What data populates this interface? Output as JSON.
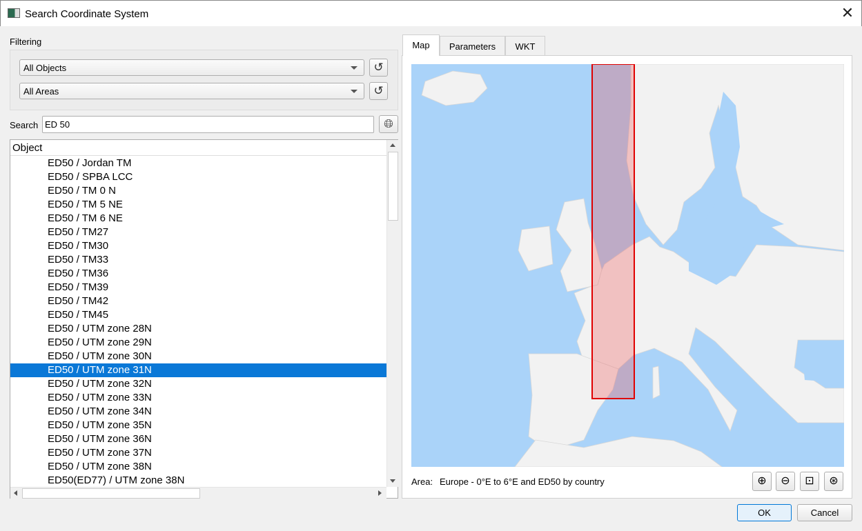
{
  "window": {
    "title": "Search Coordinate System",
    "close": "✕"
  },
  "filtering": {
    "label": "Filtering",
    "objects_combo": "All Objects",
    "areas_combo": "All Areas"
  },
  "search": {
    "label": "Search",
    "value": "ED 50"
  },
  "tree": {
    "header": "Object",
    "rows": [
      "ED50 / Jordan TM",
      "ED50 / SPBA LCC",
      "ED50 / TM 0 N",
      "ED50 / TM 5 NE",
      "ED50 / TM 6 NE",
      "ED50 / TM27",
      "ED50 / TM30",
      "ED50 / TM33",
      "ED50 / TM36",
      "ED50 / TM39",
      "ED50 / TM42",
      "ED50 / TM45",
      "ED50 / UTM zone 28N",
      "ED50 / UTM zone 29N",
      "ED50 / UTM zone 30N",
      "ED50 / UTM zone 31N",
      "ED50 / UTM zone 32N",
      "ED50 / UTM zone 33N",
      "ED50 / UTM zone 34N",
      "ED50 / UTM zone 35N",
      "ED50 / UTM zone 36N",
      "ED50 / UTM zone 37N",
      "ED50 / UTM zone 38N",
      "ED50(ED77) / UTM zone 38N"
    ],
    "selected_index": 15
  },
  "tabs": [
    "Map",
    "Parameters",
    "WKT"
  ],
  "map": {
    "area_label": "Area:",
    "area_value": "Europe - 0°E to 6°E and ED50 by country",
    "extent_west_lon": 0,
    "extent_east_lon": 6,
    "colors": {
      "water": "#aad3f9",
      "land": "#f2f2f2",
      "extent": "#e00000"
    }
  },
  "buttons": {
    "ok": "OK",
    "cancel": "Cancel"
  }
}
